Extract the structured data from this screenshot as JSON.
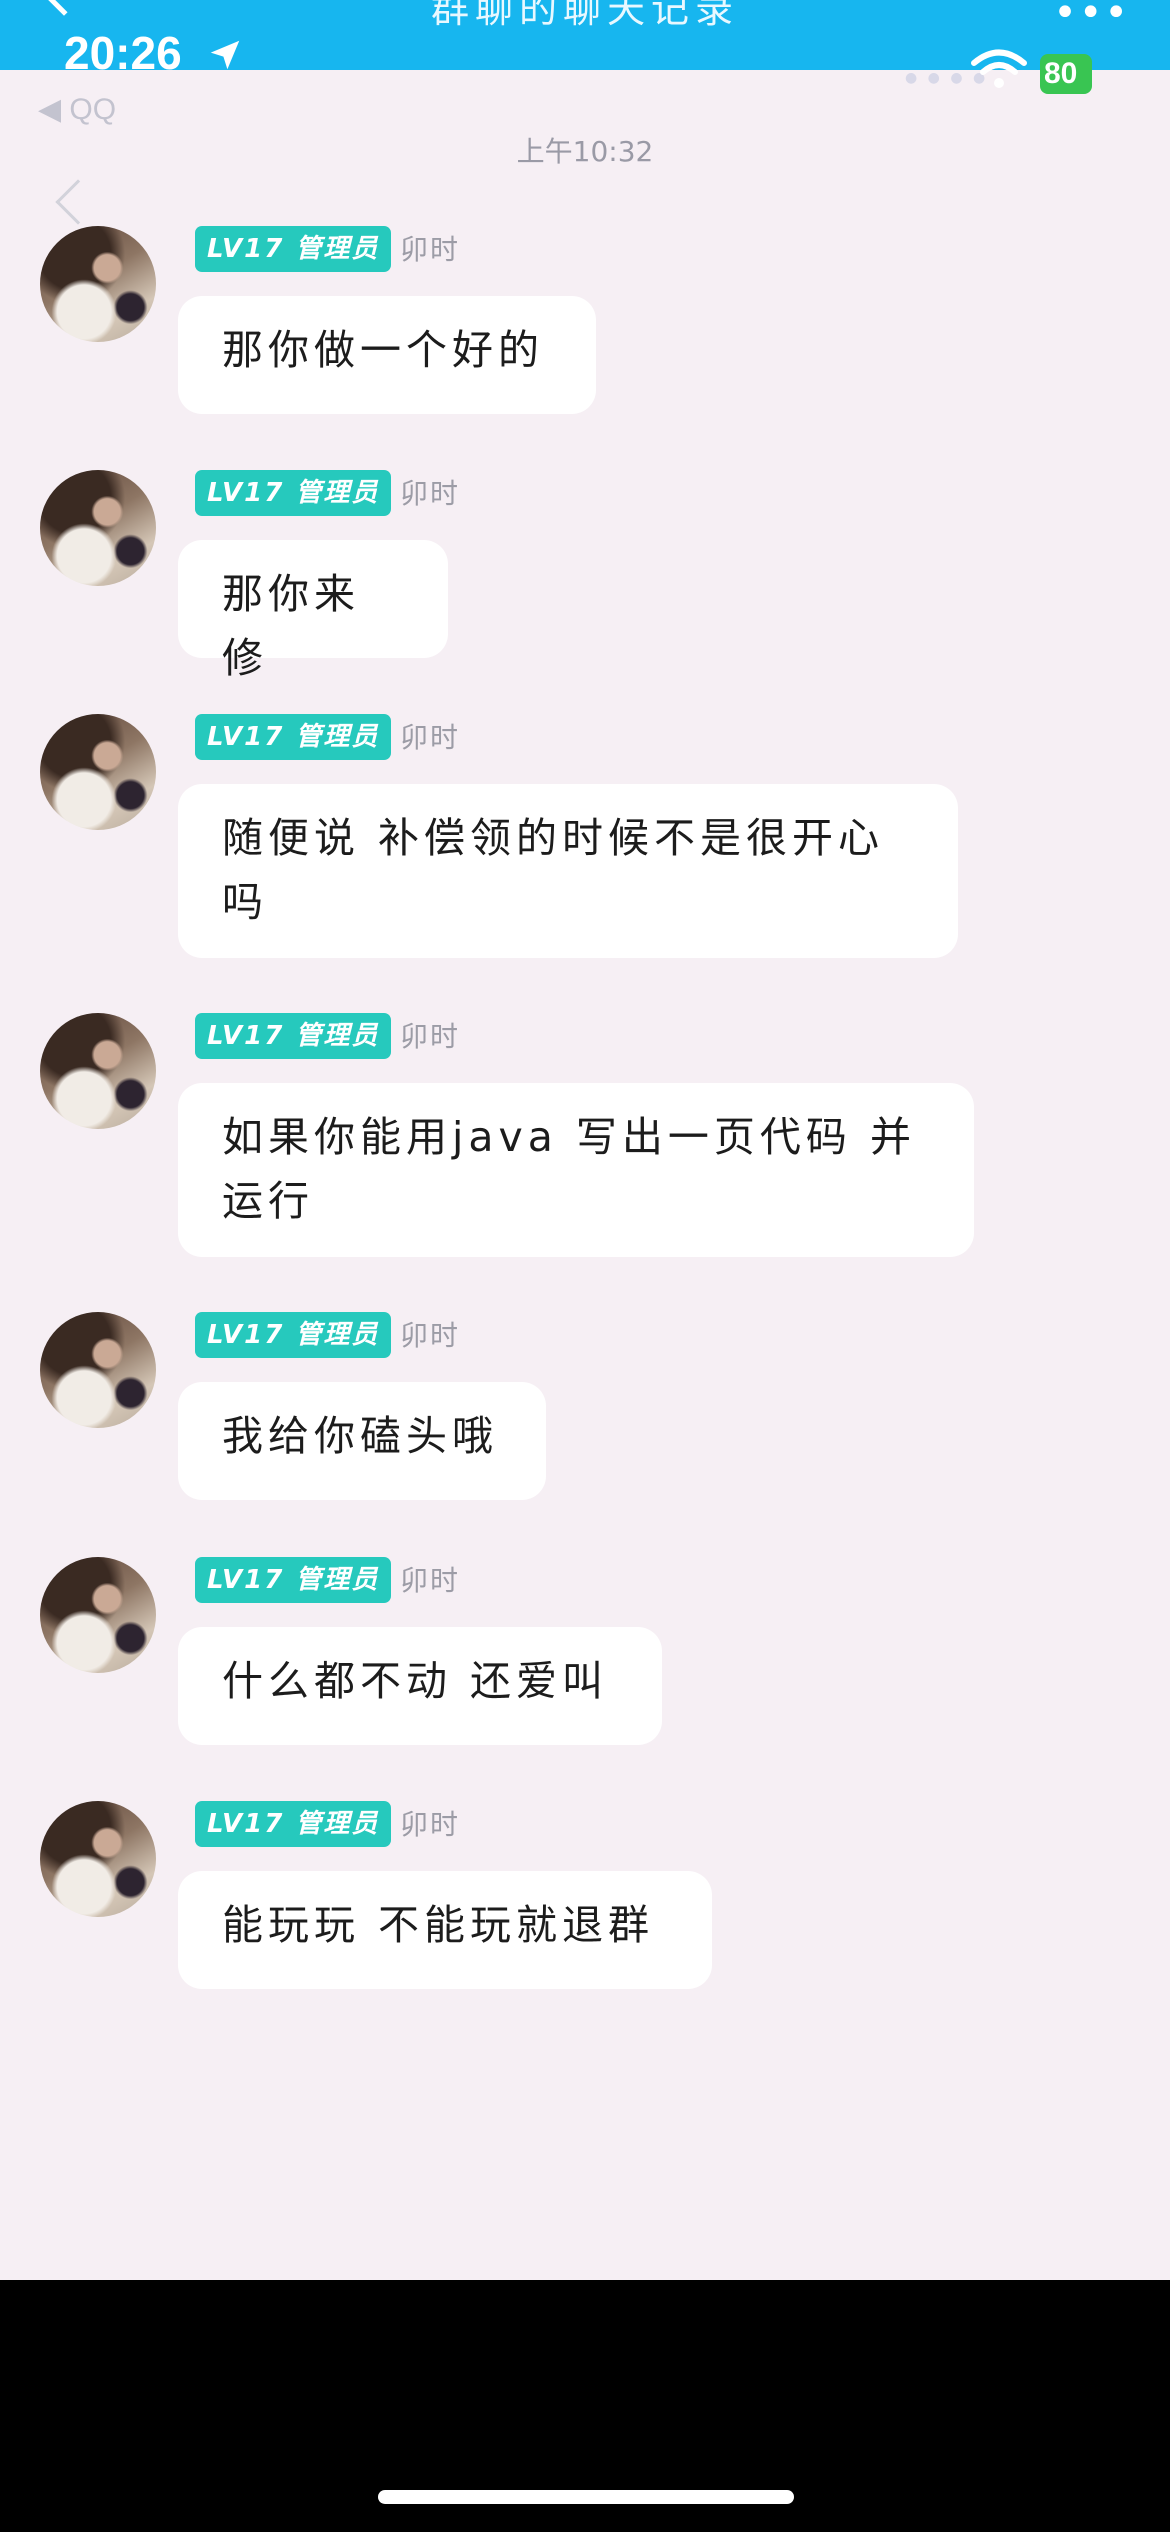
{
  "header": {
    "title": "群聊的聊天记录",
    "more": "•••"
  },
  "status_bar": {
    "time": "20:26",
    "battery": "80",
    "back_app": "◀ QQ"
  },
  "time_divider": "上午10:32",
  "sender": {
    "level_badge": "LV17 管理员",
    "title": "卯时"
  },
  "messages": [
    {
      "text": "那你做一个好的"
    },
    {
      "text": "那你来修"
    },
    {
      "text": "随便说 补偿领的时候不是很开心吗"
    },
    {
      "text": "如果你能用java 写出一页代码 并运行"
    },
    {
      "text": "我给你磕头哦"
    },
    {
      "text": "什么都不动 还爱叫"
    },
    {
      "text": "能玩玩 不能玩就退群"
    }
  ],
  "colors": {
    "header": "#17b6ef",
    "badge": "#26c9bd",
    "background": "#f6eff4",
    "bubble": "#ffffff"
  }
}
